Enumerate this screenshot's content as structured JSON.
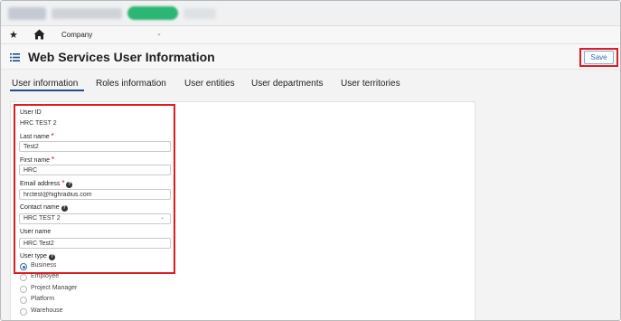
{
  "nav": {
    "company": "Company"
  },
  "header": {
    "title": "Web Services User Information",
    "save_label": "Save"
  },
  "tabs": [
    {
      "label": "User information",
      "active": true
    },
    {
      "label": "Roles information",
      "active": false
    },
    {
      "label": "User entities",
      "active": false
    },
    {
      "label": "User departments",
      "active": false
    },
    {
      "label": "User territories",
      "active": false
    }
  ],
  "form": {
    "user_id": {
      "label": "User ID",
      "value": "HRC TEST 2"
    },
    "last_name": {
      "label": "Last name",
      "value": "Test2",
      "required": true
    },
    "first_name": {
      "label": "First name",
      "value": "HRC",
      "required": true
    },
    "email": {
      "label": "Email address",
      "value": "hrctest@highradius.com",
      "required": true
    },
    "contact_name": {
      "label": "Contact name",
      "value": "HRC TEST 2"
    },
    "user_name": {
      "label": "User name",
      "value": "HRC Test2"
    },
    "user_type": {
      "label": "User type",
      "options": [
        "Business",
        "Employee",
        "Project Manager",
        "Platform",
        "Warehouse"
      ],
      "selected": "Business"
    }
  },
  "colors": {
    "accent": "#2f6fb0",
    "highlight": "#e11b22",
    "required": "#d0021b",
    "tab_underline": "#1f4f8f"
  }
}
